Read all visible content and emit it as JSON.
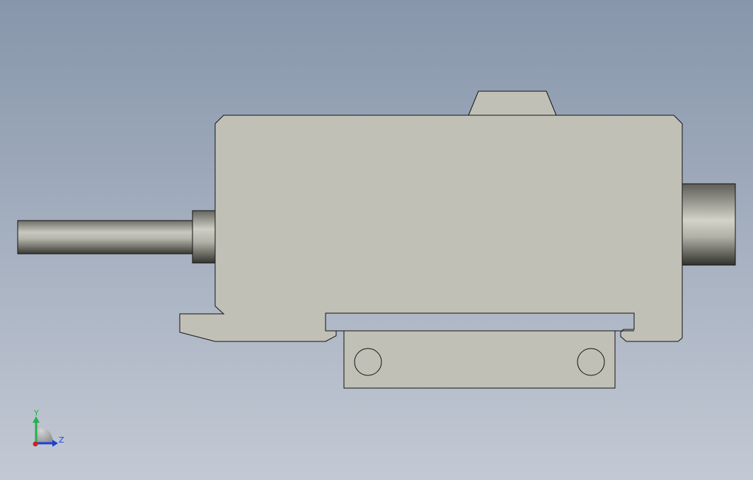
{
  "viewport": {
    "background_top": "#8796ab",
    "background_bottom": "#c3c9d4"
  },
  "model": {
    "body_color": "#c1c0b6",
    "outline_color": "#111111",
    "cylinder_dark": "#3a3a36",
    "cylinder_light": "#d4d3c9"
  },
  "triad": {
    "y_label": "Y",
    "z_label": "Z",
    "y_color": "#22b14c",
    "z_color": "#1e3fd8",
    "x_color": "#d02020"
  }
}
